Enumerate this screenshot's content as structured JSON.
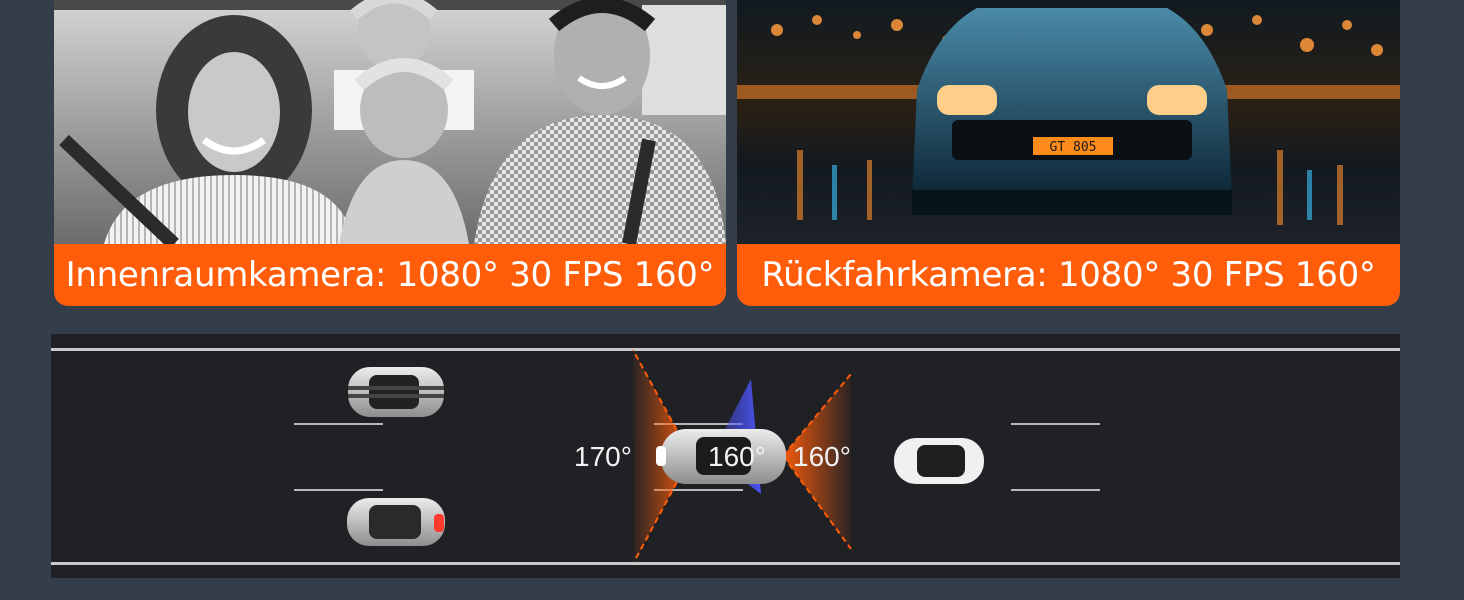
{
  "cameras": {
    "interior": {
      "caption": "Innenraumkamera: 1080° 30 FPS 160°"
    },
    "rear": {
      "caption": "Rückfahrkamera: 1080° 30 FPS 160°",
      "plate": "GT 805"
    }
  },
  "diagram": {
    "front_angle": "170°",
    "interior_angle": "160°",
    "rear_angle": "160°"
  },
  "colors": {
    "accent": "#ff5d0a",
    "interior_fov": "#4d55ff",
    "background": "#343d4a",
    "road": "#1f2124"
  }
}
